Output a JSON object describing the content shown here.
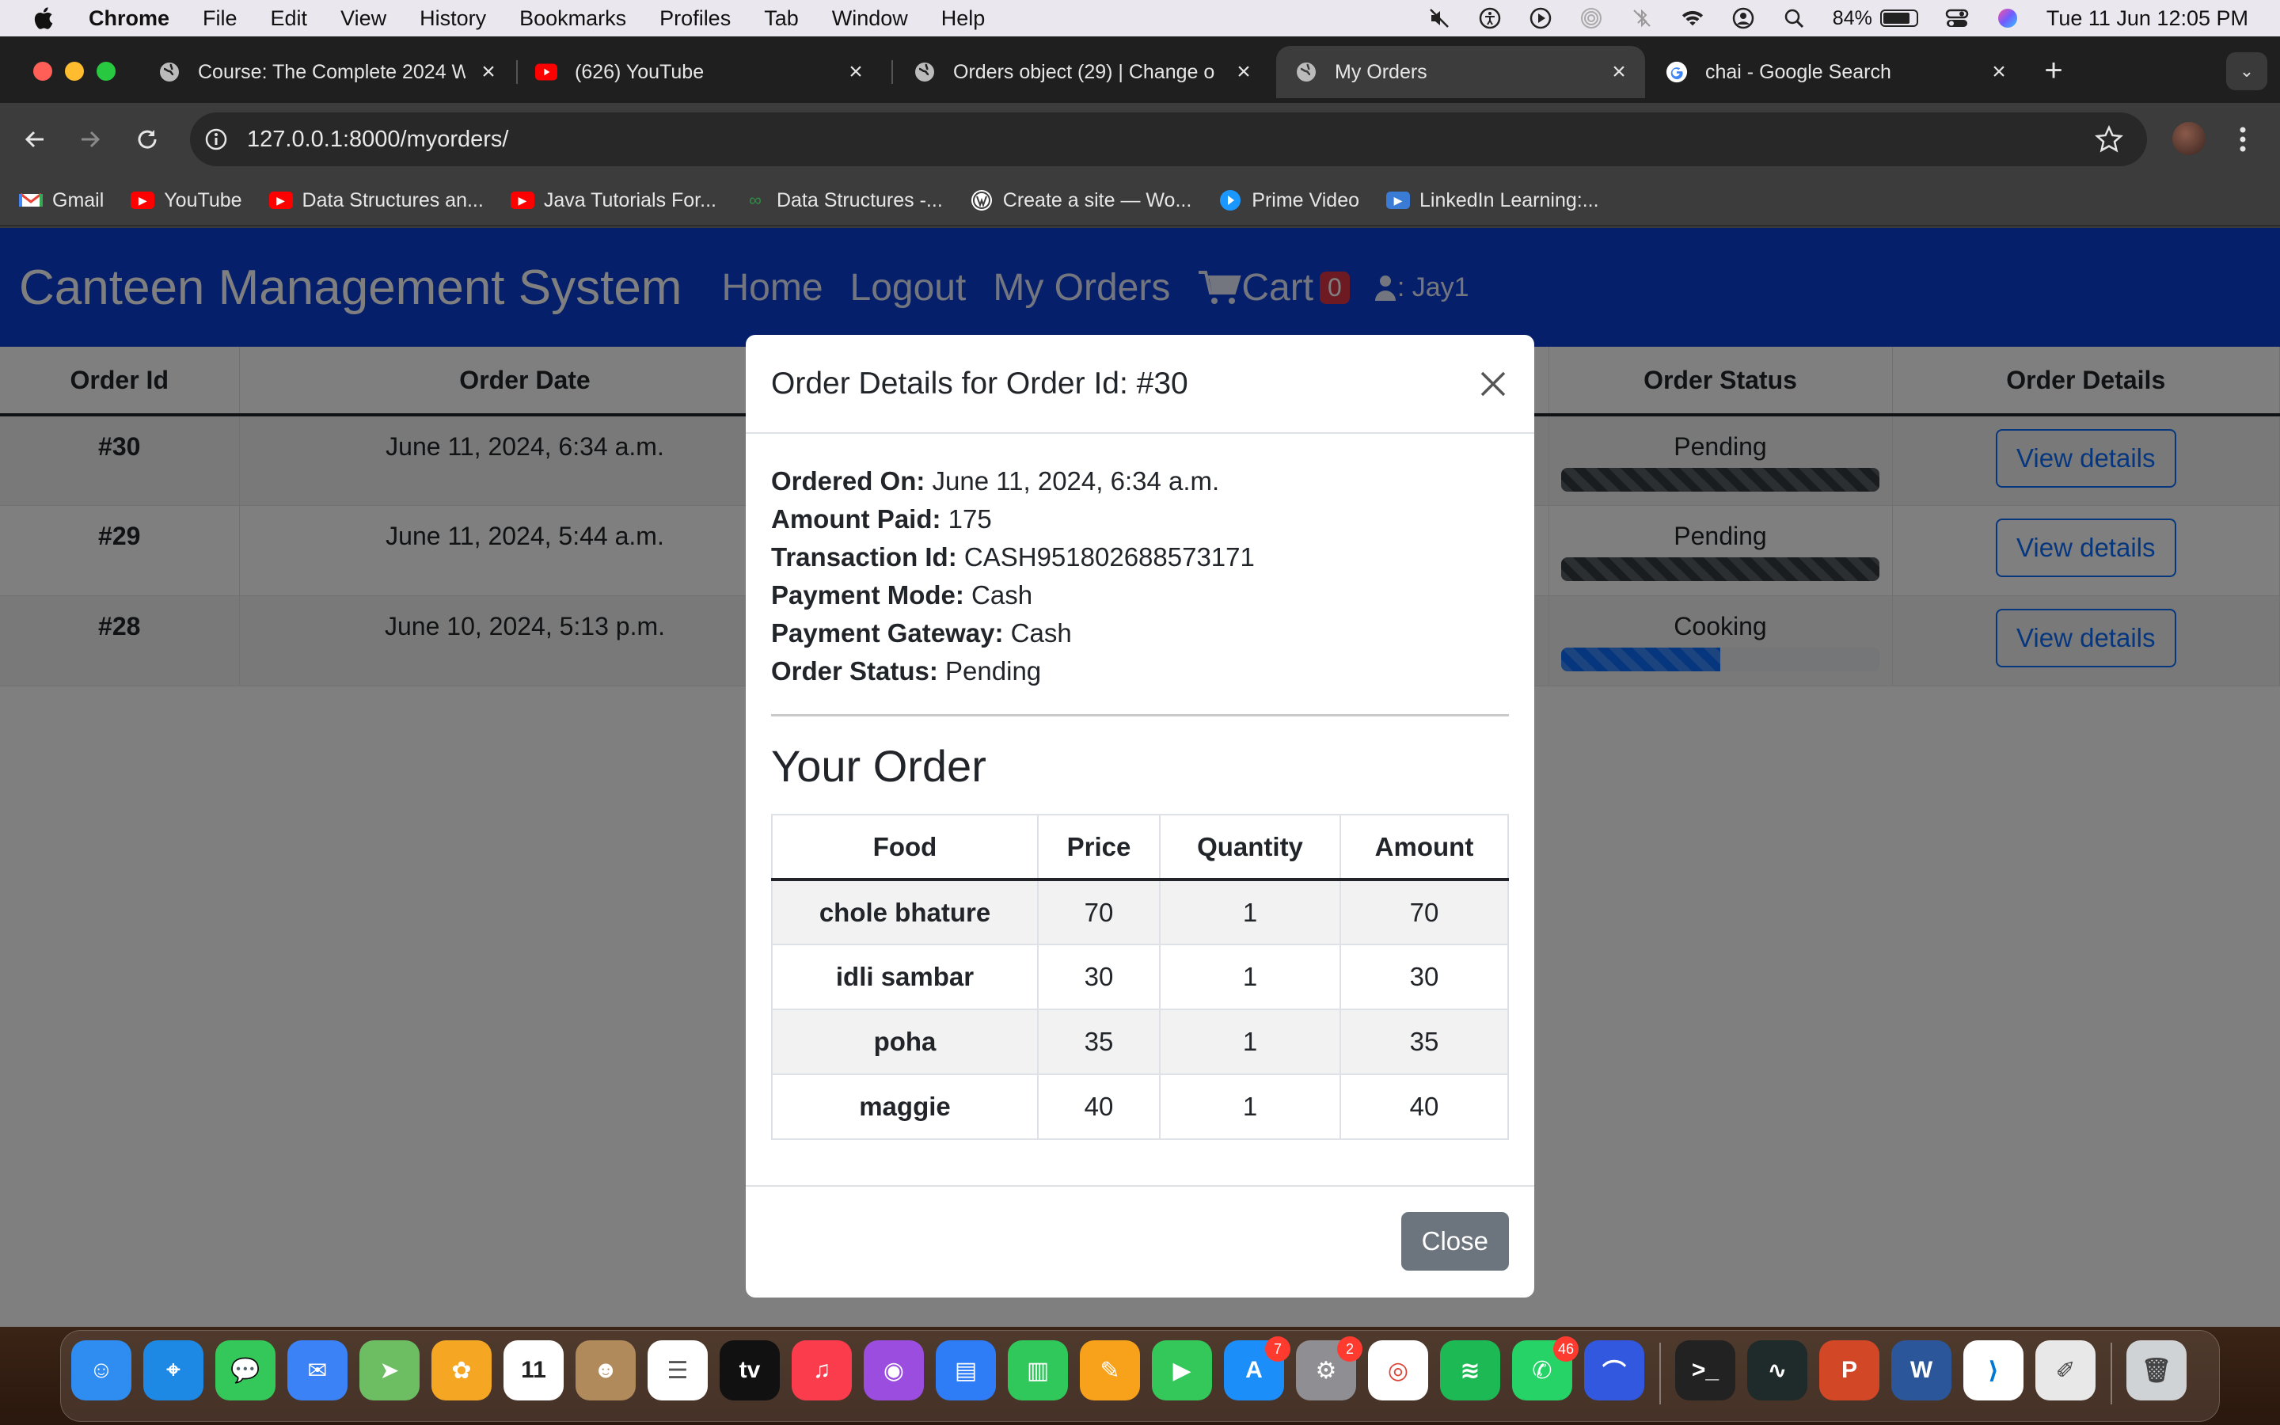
{
  "menubar": {
    "app_name": "Chrome",
    "items": [
      "File",
      "Edit",
      "View",
      "History",
      "Bookmarks",
      "Profiles",
      "Tab",
      "Window",
      "Help"
    ],
    "battery_percent": "84%",
    "battery_level": 0.84,
    "clock": "Tue 11 Jun  12:05 PM"
  },
  "browser": {
    "tabs": [
      {
        "title": "Course: The Complete 2024 W",
        "icon": "globe-icon",
        "active": false
      },
      {
        "title": "(626) YouTube",
        "icon": "youtube-icon",
        "active": false
      },
      {
        "title": "Orders object (29) | Change o",
        "icon": "globe-icon",
        "active": false
      },
      {
        "title": "My Orders",
        "icon": "globe-icon",
        "active": true
      },
      {
        "title": "chai - Google Search",
        "icon": "google-icon",
        "active": false
      }
    ],
    "url": "127.0.0.1:8000/myorders/",
    "bookmarks": [
      {
        "label": "Gmail",
        "icon": "gmail-icon",
        "color": "#ea4335"
      },
      {
        "label": "YouTube",
        "icon": "youtube-icon",
        "color": "#ff0000"
      },
      {
        "label": "Data Structures an...",
        "icon": "youtube-icon",
        "color": "#ff0000"
      },
      {
        "label": "Java Tutorials For...",
        "icon": "youtube-icon",
        "color": "#ff0000"
      },
      {
        "label": "Data Structures -...",
        "icon": "gfg-icon",
        "color": "#2f8d46"
      },
      {
        "label": "Create a site — Wo...",
        "icon": "wordpress-icon",
        "color": "#ffffff"
      },
      {
        "label": "Prime Video",
        "icon": "prime-video-icon",
        "color": "#1a98ff"
      },
      {
        "label": "LinkedIn Learning:...",
        "icon": "linkedin-learning-icon",
        "color": "#3a7bd5"
      }
    ]
  },
  "site": {
    "brand": "Canteen Management System",
    "nav": [
      "Home",
      "Logout",
      "My Orders"
    ],
    "cart_label": "Cart",
    "cart_count": "0",
    "user": ": Jay1",
    "colors": {
      "navbar": "#0b3fd6",
      "primary": "#0d6efd",
      "dark": "#343a40"
    }
  },
  "orders": {
    "headers": [
      "Order Id",
      "Order Date",
      "Order Status",
      "Order Details"
    ],
    "rows": [
      {
        "id": "#30",
        "date": "June 11, 2024, 6:34 a.m.",
        "status": "Pending",
        "progress": 1.0,
        "bar_color": "#343a40",
        "details": "View details"
      },
      {
        "id": "#29",
        "date": "June 11, 2024, 5:44 a.m.",
        "status": "Pending",
        "progress": 1.0,
        "bar_color": "#343a40",
        "details": "View details"
      },
      {
        "id": "#28",
        "date": "June 10, 2024, 5:13 p.m.",
        "status": "Cooking",
        "progress": 0.5,
        "bar_color": "#0d6efd",
        "details": "View details"
      }
    ]
  },
  "modal": {
    "title": "Order Details for Order Id: #30",
    "details": [
      {
        "label": "Ordered On:",
        "value": "June 11, 2024, 6:34 a.m."
      },
      {
        "label": "Amount Paid:",
        "value": "175"
      },
      {
        "label": "Transaction Id:",
        "value": "CASH951802688573171"
      },
      {
        "label": "Payment Mode:",
        "value": "Cash"
      },
      {
        "label": "Payment Gateway:",
        "value": "Cash"
      },
      {
        "label": "Order Status:",
        "value": "Pending"
      }
    ],
    "section_title": "Your Order",
    "table_headers": [
      "Food",
      "Price",
      "Quantity",
      "Amount"
    ],
    "items": [
      {
        "food": "chole bhature",
        "price": "70",
        "qty": "1",
        "amount": "70"
      },
      {
        "food": "idli sambar",
        "price": "30",
        "qty": "1",
        "amount": "30"
      },
      {
        "food": "poha",
        "price": "35",
        "qty": "1",
        "amount": "35"
      },
      {
        "food": "maggie",
        "price": "40",
        "qty": "1",
        "amount": "40"
      }
    ],
    "close_label": "Close"
  },
  "dock": {
    "apps": [
      {
        "name": "finder-icon",
        "color": "#2f8cf0",
        "glyph": "☺"
      },
      {
        "name": "safari-icon",
        "color": "#1e88e5",
        "glyph": "⌖"
      },
      {
        "name": "messages-icon",
        "color": "#34c759",
        "glyph": "💬"
      },
      {
        "name": "mail-icon",
        "color": "#3b82f6",
        "glyph": "✉"
      },
      {
        "name": "maps-icon",
        "color": "#6dbd63",
        "glyph": "➤"
      },
      {
        "name": "photos-icon",
        "color": "#f5a623",
        "glyph": "✿"
      },
      {
        "name": "calendar-icon",
        "color": "#ffffff",
        "glyph": "11",
        "text": "#222"
      },
      {
        "name": "contacts-icon",
        "color": "#b08a5a",
        "glyph": "☻"
      },
      {
        "name": "reminders-icon",
        "color": "#ffffff",
        "glyph": "☰",
        "text": "#555"
      },
      {
        "name": "apple-tv-icon",
        "color": "#111111",
        "glyph": "tv"
      },
      {
        "name": "music-icon",
        "color": "#fa3c4c",
        "glyph": "♫"
      },
      {
        "name": "podcasts-icon",
        "color": "#9b4de0",
        "glyph": "◉"
      },
      {
        "name": "keynote-icon",
        "color": "#2f7df6",
        "glyph": "▤"
      },
      {
        "name": "numbers-icon",
        "color": "#30c85a",
        "glyph": "▥"
      },
      {
        "name": "pages-icon",
        "color": "#f7a21a",
        "glyph": "✎"
      },
      {
        "name": "facetime-icon",
        "color": "#34c759",
        "glyph": "▶"
      },
      {
        "name": "app-store-icon",
        "color": "#1c8ef9",
        "glyph": "A",
        "badge": "7"
      },
      {
        "name": "system-settings-icon",
        "color": "#8e8e93",
        "glyph": "⚙",
        "badge": "2"
      },
      {
        "name": "chrome-icon",
        "color": "#ffffff",
        "glyph": "◎",
        "text": "#db4437"
      },
      {
        "name": "spotify-icon",
        "color": "#1db954",
        "glyph": "≋"
      },
      {
        "name": "whatsapp-icon",
        "color": "#25d366",
        "glyph": "✆",
        "badge": "46"
      },
      {
        "name": "arc-icon",
        "color": "#3358e0",
        "glyph": "⌒"
      },
      {
        "name": "terminal-icon",
        "color": "#222222",
        "glyph": ">_"
      },
      {
        "name": "activity-monitor-icon",
        "color": "#1f2a2a",
        "glyph": "∿"
      },
      {
        "name": "powerpoint-icon",
        "color": "#d24726",
        "glyph": "P"
      },
      {
        "name": "word-icon",
        "color": "#2b579a",
        "glyph": "W"
      },
      {
        "name": "vscode-icon",
        "color": "#ffffff",
        "glyph": "⟩",
        "text": "#0078d4"
      },
      {
        "name": "script-editor-icon",
        "color": "#e8e8e8",
        "glyph": "✐",
        "text": "#444"
      },
      {
        "name": "trash-icon",
        "color": "#cfd3d6",
        "glyph": "🗑",
        "text": "#444"
      }
    ]
  }
}
